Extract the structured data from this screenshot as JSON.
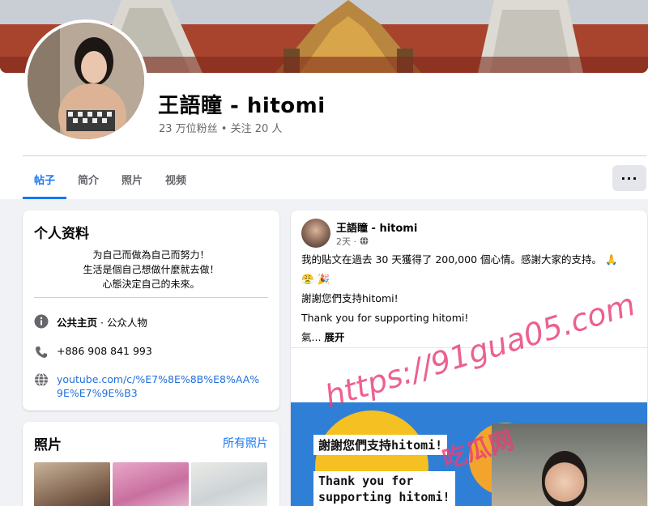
{
  "profile": {
    "name": "王語瞳 - hitomi",
    "stats": "23 万位粉丝 • 关注 20 人"
  },
  "tabs": [
    {
      "label": "帖子",
      "active": true
    },
    {
      "label": "简介",
      "active": false
    },
    {
      "label": "照片",
      "active": false
    },
    {
      "label": "视频",
      "active": false
    }
  ],
  "more_label": "···",
  "intro": {
    "title": "个人资料",
    "bio_lines": [
      "为自己而做為自己而努力！",
      "生活是個自己想做什麼就去做！",
      "心態決定自己的未來。"
    ],
    "category_label": "公共主页",
    "category_value": " · 公众人物",
    "phone": "+886 908 841 993",
    "link": "youtube.com/c/%E7%8E%8B%E8%AA%9E%E7%9E%B3"
  },
  "photos": {
    "title": "照片",
    "all_link": "所有照片"
  },
  "post": {
    "author": "王語瞳 - hitomi",
    "time": "2天 ·",
    "lines": [
      "我的貼文在過去 30 天獲得了 200,000 個心情。感謝大家的支持。 🙏",
      "😤 🎉",
      "謝謝您們支持hitomi!",
      "Thank you for supporting hitomi!"
    ],
    "truncated": "氣...",
    "expand_label": "展开",
    "image_text_1": "謝謝您們支持hitomi!",
    "image_text_2a": "Thank you for",
    "image_text_2b": "supporting hitomi!"
  },
  "watermark": {
    "line1": "https://91gua05.com",
    "line2": "吃瓜网"
  },
  "colors": {
    "accent": "#1877f2",
    "watermark": "#e83e78"
  }
}
